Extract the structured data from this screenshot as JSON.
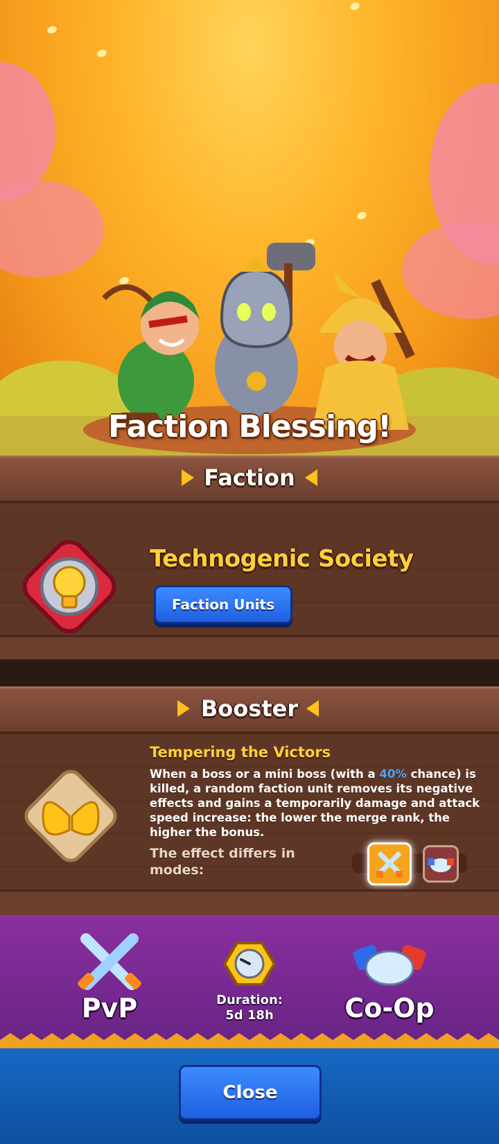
{
  "banner": {
    "title": "Faction Blessing!"
  },
  "faction": {
    "header": "Faction",
    "name": "Technogenic Society",
    "units_button": "Faction Units",
    "icon": "lightbulb-gear-icon"
  },
  "booster": {
    "header": "Booster",
    "title": "Tempering the Victors",
    "desc_part1": "When a boss or a mini boss (with a ",
    "desc_highlight": "40%",
    "desc_part2": " chance) is killed, a random faction unit removes its negative effects and gains a temporarily damage and attack speed increase: the lower the merge rank, the higher the bonus.",
    "modes_label": "The effect differs in modes:",
    "icon": "golden-wings-icon",
    "mode_tabs": [
      {
        "icon": "crossed-swords-icon",
        "selected": true
      },
      {
        "icon": "handshake-icon",
        "selected": false
      }
    ]
  },
  "modes": {
    "pvp_label": "PvP",
    "coop_label": "Co-Op",
    "duration_label": "Duration:",
    "duration_value": "5d 18h"
  },
  "footer": {
    "close_button": "Close"
  },
  "colors": {
    "title_gold": "#ffcf3a",
    "panel_brown": "#5e3626",
    "modes_purple": "#7a2894",
    "button_blue": "#2f74f0",
    "highlight_blue": "#4aa3ff"
  }
}
